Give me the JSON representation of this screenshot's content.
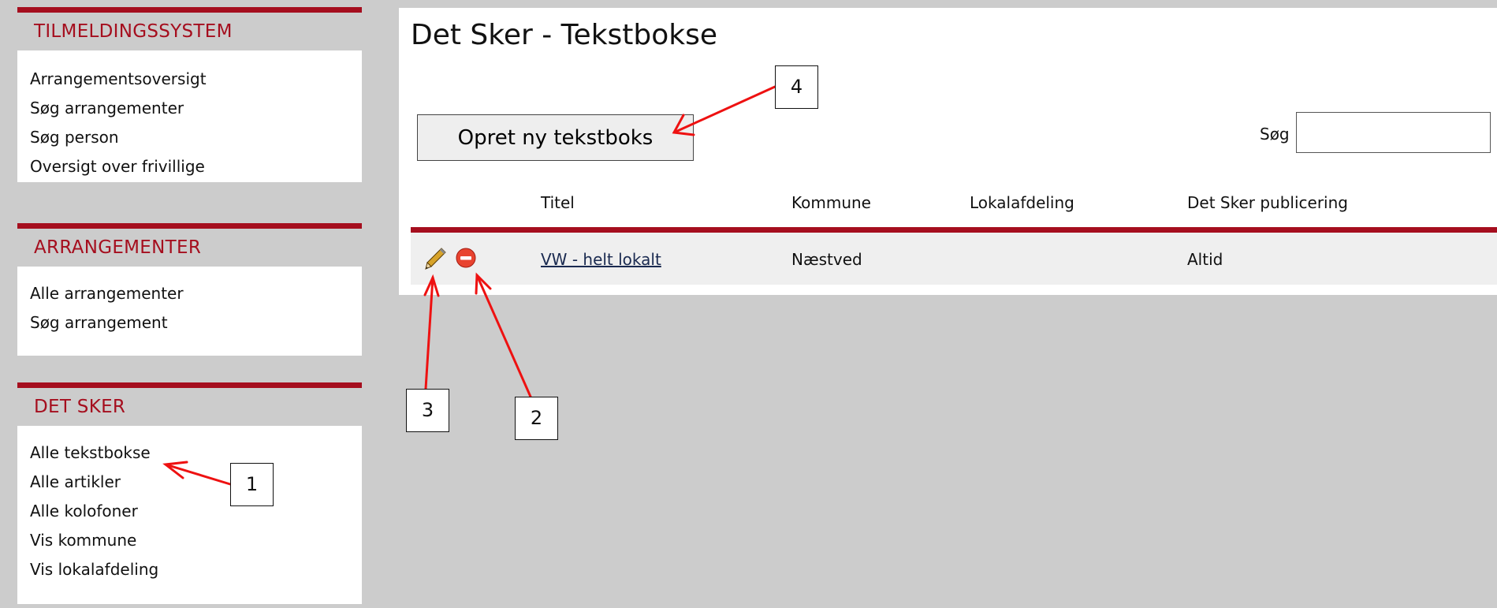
{
  "sidebar": {
    "sections": [
      {
        "heading": "TILMELDINGSSYSTEM",
        "items": [
          "Arrangementsoversigt",
          "Søg arrangementer",
          "Søg person",
          "Oversigt over frivillige"
        ]
      },
      {
        "heading": "ARRANGEMENTER",
        "items": [
          "Alle arrangementer",
          "Søg arrangement"
        ]
      },
      {
        "heading": "DET SKER",
        "items": [
          "Alle tekstbokse",
          "Alle artikler",
          "Alle kolofoner",
          "Vis kommune",
          "Vis lokalafdeling"
        ]
      }
    ]
  },
  "page": {
    "title": "Det Sker - Tekstbokse",
    "new_button": "Opret ny tekstboks",
    "search_label": "Søg",
    "search_value": ""
  },
  "table": {
    "headers": [
      "Titel",
      "Kommune",
      "Lokalafdeling",
      "Det Sker publicering"
    ],
    "rows": [
      {
        "titel": "VW - helt lokalt",
        "kommune": "Næstved",
        "lokalafdeling": "",
        "publicering": "Altid",
        "icons": [
          "pencil-icon",
          "delete-icon"
        ]
      }
    ]
  },
  "callouts": [
    "1",
    "2",
    "3",
    "4"
  ],
  "colors": {
    "accent": "#a50e1e",
    "arrow": "#ee1111",
    "background": "#cccccc"
  }
}
